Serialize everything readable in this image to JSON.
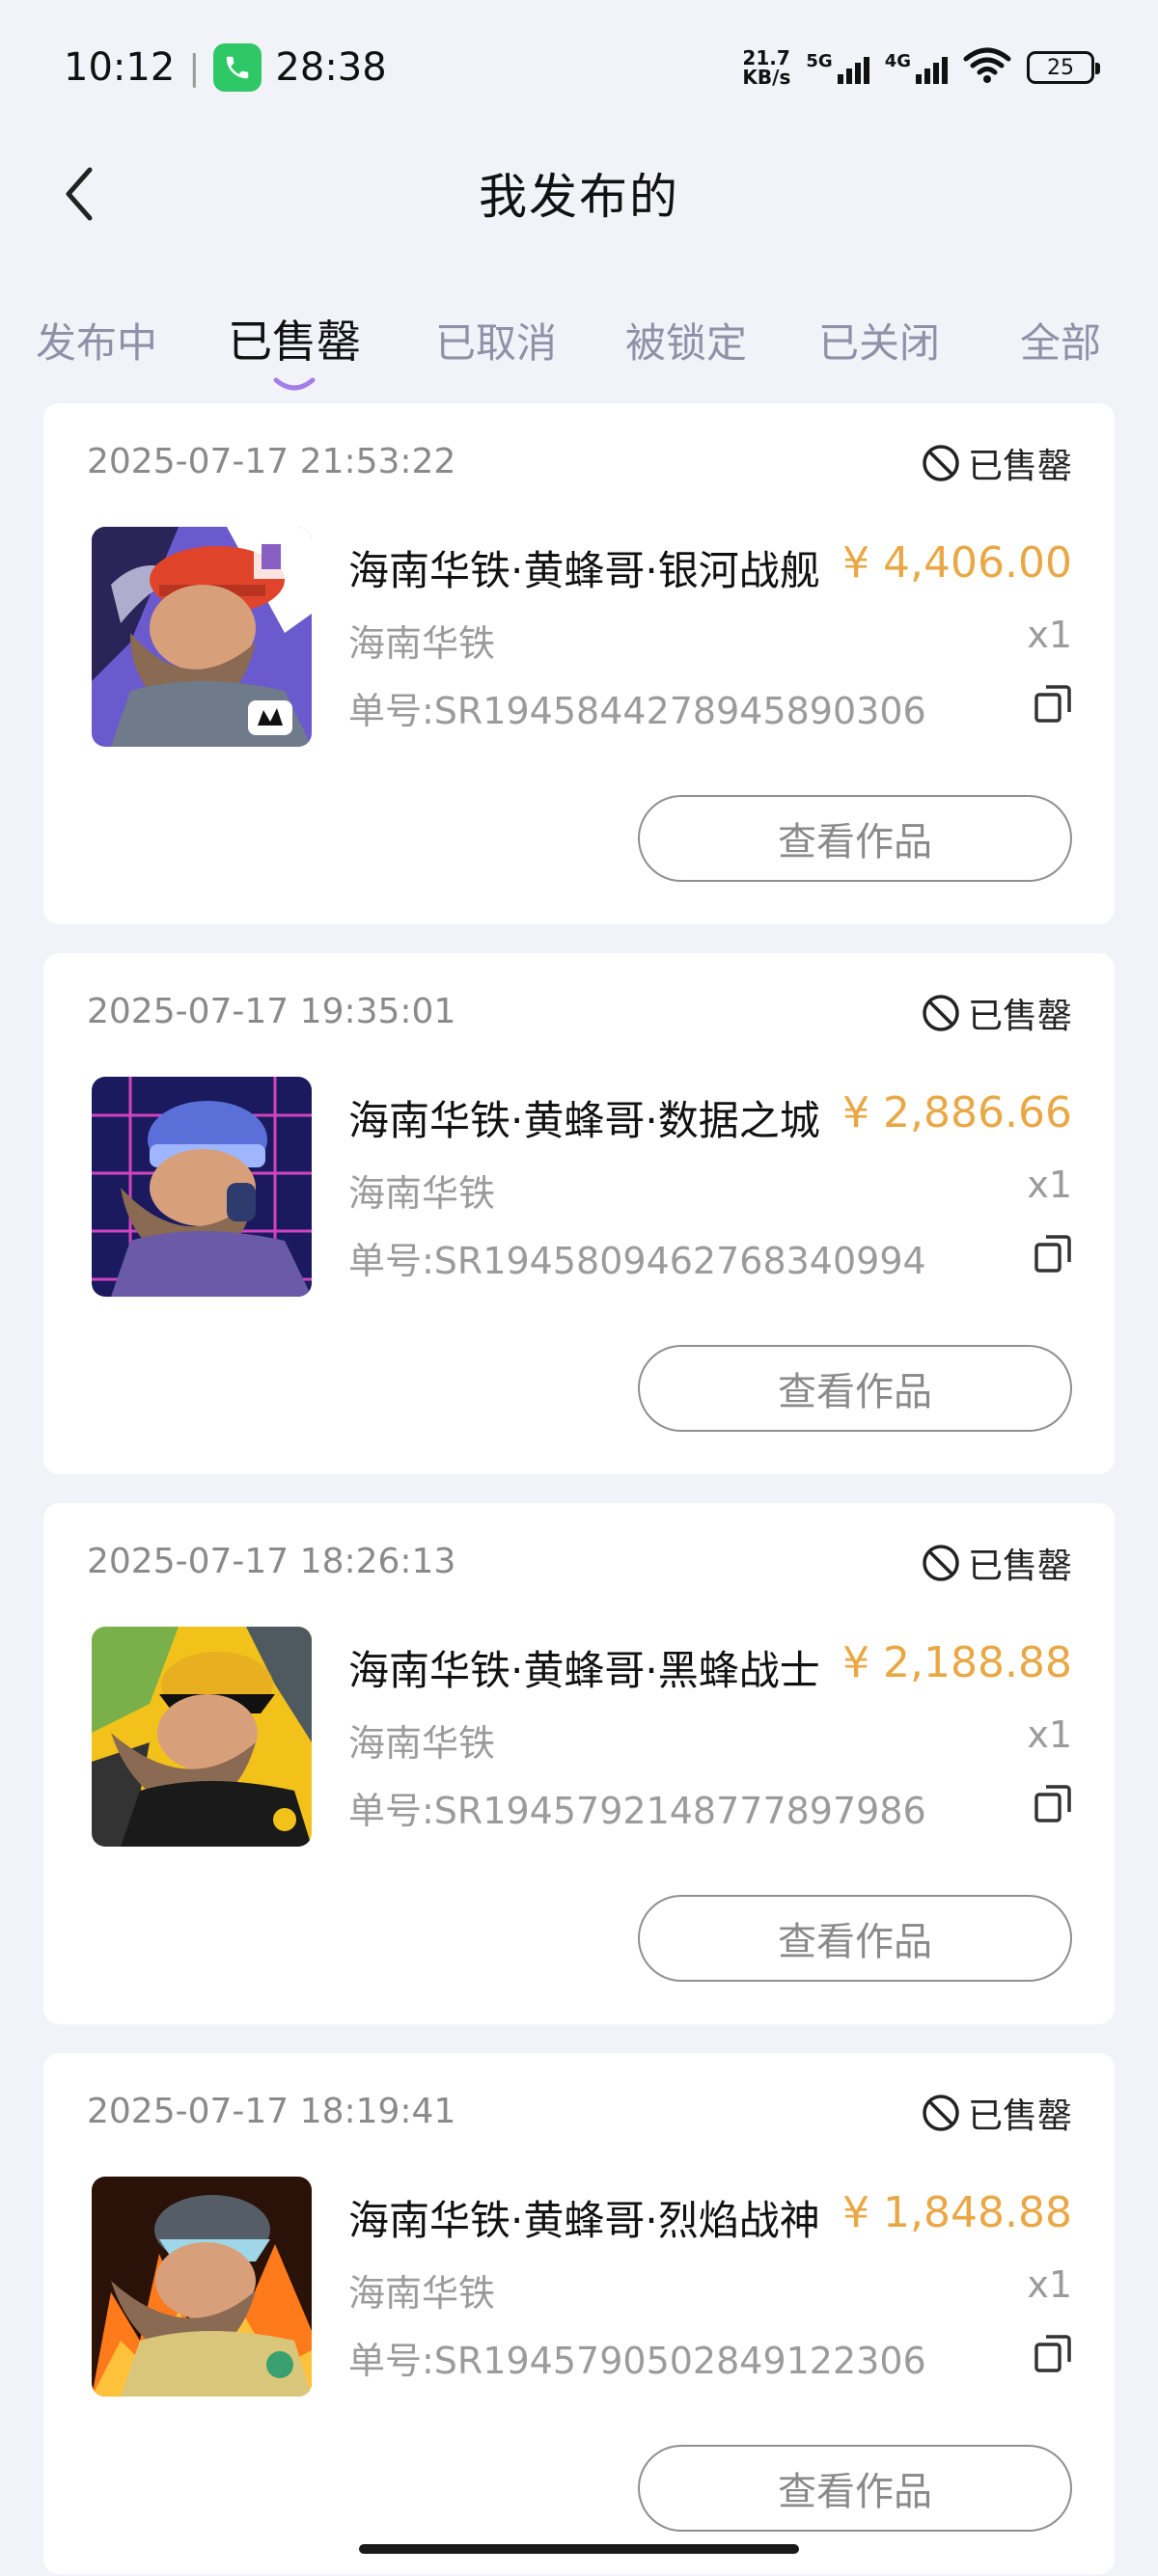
{
  "status_bar": {
    "time": "10:12",
    "call_duration": "28:38",
    "net_speed_value": "21.7",
    "net_speed_unit": "KB/s",
    "signal1_label": "5G",
    "signal2_label": "4G",
    "battery": "25"
  },
  "header": {
    "title": "我发布的"
  },
  "tabs": [
    {
      "label": "发布中"
    },
    {
      "label": "已售罄",
      "active": true
    },
    {
      "label": "已取消"
    },
    {
      "label": "被锁定"
    },
    {
      "label": "已关闭"
    },
    {
      "label": "全部"
    }
  ],
  "orders": [
    {
      "date": "2025-07-17 21:53:22",
      "status": "已售罄",
      "name": "海南华铁·黄蜂哥·银河战舰",
      "price": "¥ 4,406.00",
      "brand": "海南华铁",
      "qty": "x1",
      "order_no": "单号:SR1945844278945890306",
      "button": "查看作品"
    },
    {
      "date": "2025-07-17 19:35:01",
      "status": "已售罄",
      "name": "海南华铁·黄蜂哥·数据之城",
      "price": "¥ 2,886.66",
      "brand": "海南华铁",
      "qty": "x1",
      "order_no": "单号:SR1945809462768340994",
      "button": "查看作品"
    },
    {
      "date": "2025-07-17 18:26:13",
      "status": "已售罄",
      "name": "海南华铁·黄蜂哥·黑蜂战士",
      "price": "¥ 2,188.88",
      "brand": "海南华铁",
      "qty": "x1",
      "order_no": "单号:SR1945792148777897986",
      "button": "查看作品"
    },
    {
      "date": "2025-07-17 18:19:41",
      "status": "已售罄",
      "name": "海南华铁·黄蜂哥·烈焰战神",
      "price": "¥ 1,848.88",
      "brand": "海南华铁",
      "qty": "x1",
      "order_no": "单号:SR1945790502849122306",
      "button": "查看作品"
    }
  ],
  "colors": {
    "accent": "#e9a845",
    "tab_indicator": "#a47ee8",
    "background": "#f2f3f8"
  }
}
